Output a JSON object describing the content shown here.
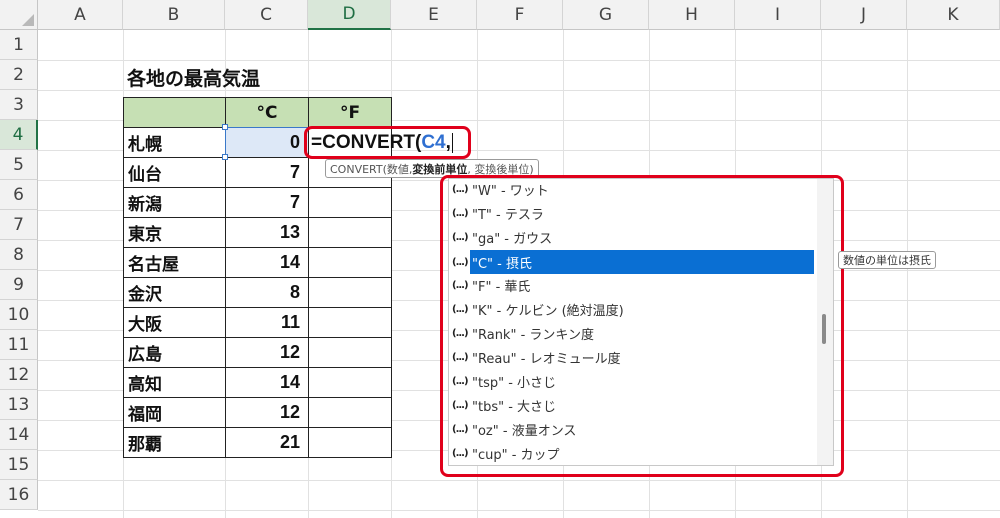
{
  "columns": [
    "A",
    "B",
    "C",
    "D",
    "E",
    "F",
    "G",
    "H",
    "I",
    "J",
    "K"
  ],
  "rows": [
    "1",
    "2",
    "3",
    "4",
    "5",
    "6",
    "7",
    "8",
    "9",
    "10",
    "11",
    "12",
    "13",
    "14",
    "15",
    "16"
  ],
  "sheet": {
    "title": "各地の最高気温",
    "header_c": "°C",
    "header_f": "°F",
    "cities": [
      "札幌",
      "仙台",
      "新潟",
      "東京",
      "名古屋",
      "金沢",
      "大阪",
      "広島",
      "高知",
      "福岡",
      "那覇"
    ],
    "temps": [
      "0",
      "7",
      "7",
      "13",
      "14",
      "8",
      "11",
      "12",
      "14",
      "12",
      "21"
    ]
  },
  "formula": {
    "prefix": "=CONVERT(",
    "ref": "C4",
    "suffix": ","
  },
  "tooltip": {
    "func": "CONVERT(数値, ",
    "bold": "変換前単位",
    "rest": ", 変換後単位)"
  },
  "autocomplete": {
    "fx_icon": "(...)",
    "items": [
      "\"W\" - ワット",
      "\"T\" - テスラ",
      "\"ga\" - ガウス",
      "\"C\" - 摂氏",
      "\"F\" - 華氏",
      "\"K\" - ケルビン (絶対温度)",
      "\"Rank\" - ランキン度",
      "\"Reau\" - レオミュール度",
      "\"tsp\" - 小さじ",
      "\"tbs\" - 大さじ",
      "\"oz\" - 液量オンス",
      "\"cup\" - カップ"
    ],
    "selected_index": 3,
    "item_tip": "数値の単位は摂氏"
  },
  "colors": {
    "accent_red": "#e0001b",
    "header_green": "#c6e0b4",
    "selection_blue": "#0a6fd3",
    "excel_green": "#217346"
  }
}
